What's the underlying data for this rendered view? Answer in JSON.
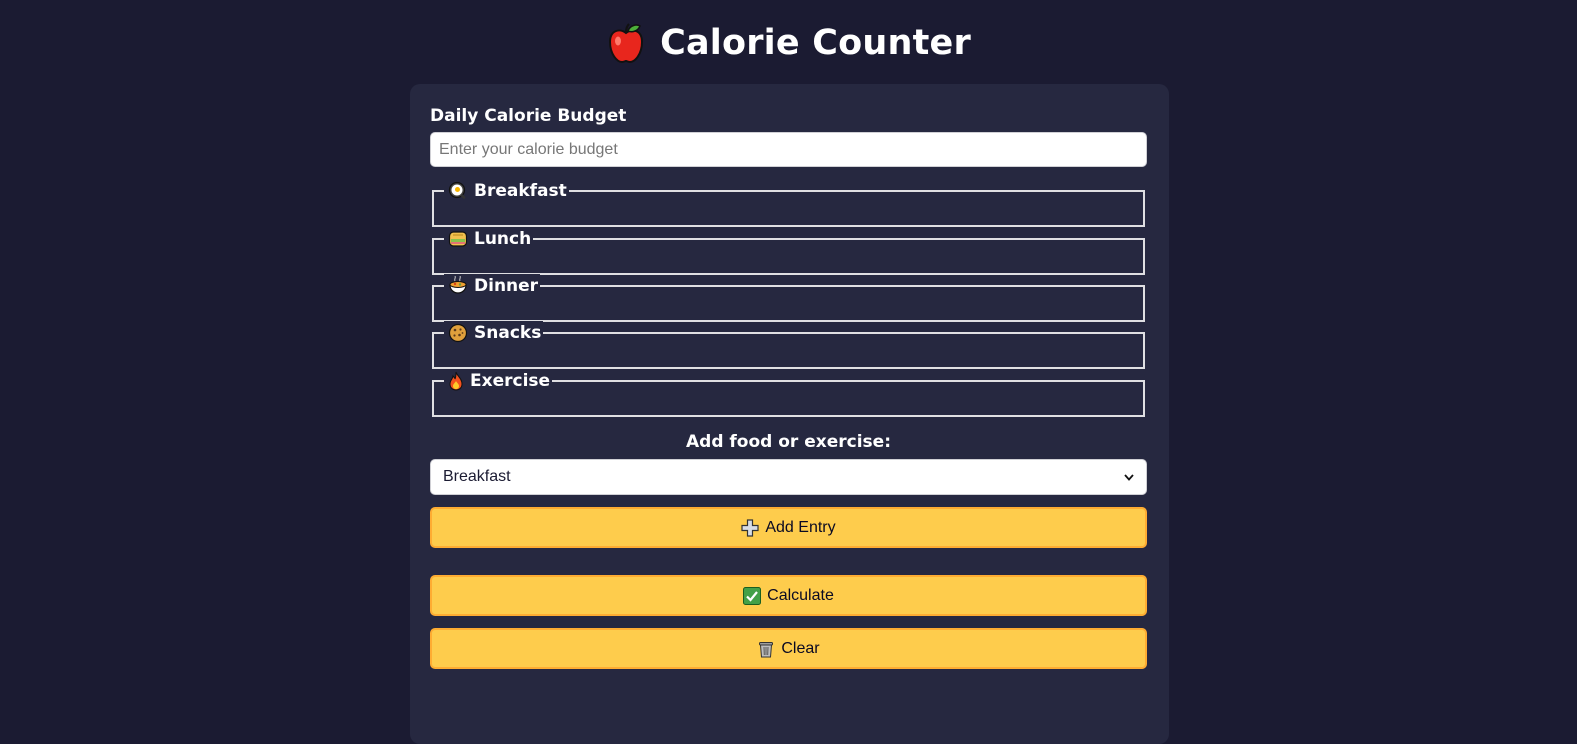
{
  "header": {
    "title": "Calorie Counter",
    "icon": "red-apple-icon"
  },
  "budget": {
    "label": "Daily Calorie Budget",
    "placeholder": "Enter your calorie budget",
    "value": ""
  },
  "sections": [
    {
      "label": "Breakfast",
      "icon": "fried-egg-icon"
    },
    {
      "label": "Lunch",
      "icon": "sandwich-icon"
    },
    {
      "label": "Dinner",
      "icon": "stew-bowl-icon"
    },
    {
      "label": "Snacks",
      "icon": "cookie-icon"
    },
    {
      "label": "Exercise",
      "icon": "fire-icon"
    }
  ],
  "add_entry": {
    "label": "Add food or exercise:",
    "selected": "Breakfast",
    "button_label": "Add Entry",
    "button_icon": "plus-icon"
  },
  "actions": {
    "calculate_label": "Calculate",
    "calculate_icon": "check-mark-icon",
    "clear_label": "Clear",
    "clear_icon": "trash-can-icon"
  },
  "colors": {
    "page_background": "#1b1b32",
    "card_background": "#262840",
    "button_background": "#fecc4c",
    "button_border": "#feac32"
  }
}
